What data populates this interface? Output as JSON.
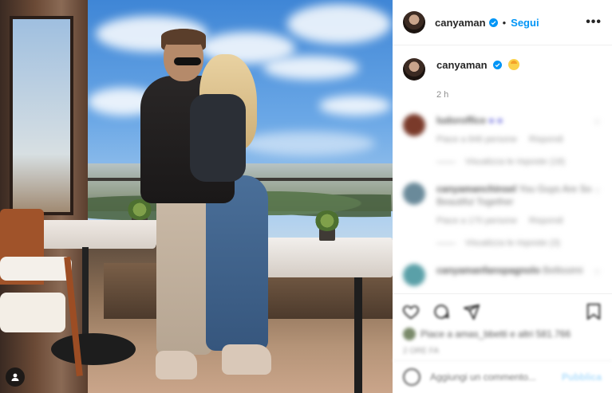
{
  "post": {
    "username": "canyaman",
    "follow_label": "Segui",
    "more_label": "•••",
    "dot": "•",
    "caption_time": "2 h",
    "caption_emoji_icon": "hatching-chick-emoji",
    "colors": {
      "follow": "#0095f6",
      "verified": "#0095f6",
      "muted": "#8e8e8e"
    }
  },
  "comments": [
    {
      "user": "ludoroffice",
      "text": "● ●",
      "meta": [
        "Piace a 846 persone",
        "Rispondi"
      ],
      "replies": "Visualizza le risposte (18)",
      "avatar_color": "#7a3a2a"
    },
    {
      "user": "canyamanchinsel",
      "text": "You Guys Are So Beautiful Together",
      "meta": [
        "Piace a 170 persone",
        "Rispondi"
      ],
      "replies": "Visualizza le risposte (3)",
      "avatar_color": "#6a8a9a"
    },
    {
      "user": "canyamanfanspagnolo",
      "text": "Bellissimi",
      "meta": [],
      "replies": "",
      "avatar_color": "#5aa0a8"
    }
  ],
  "footer": {
    "likes_text": "Piace a amas_bbetti e altri 581.766",
    "date": "2 ORE FA",
    "comment_placeholder": "Aggiungi un commento...",
    "post_label": "Pubblica"
  }
}
